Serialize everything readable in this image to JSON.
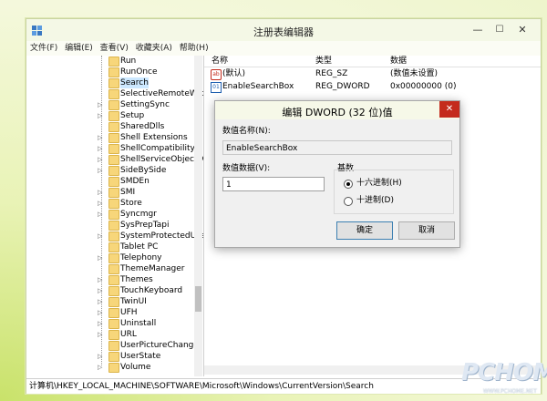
{
  "window": {
    "title": "注册表编辑器",
    "min_label": "—",
    "max_label": "☐",
    "close_label": "✕"
  },
  "menu": [
    "文件(F)",
    "编辑(E)",
    "查看(V)",
    "收藏夹(A)",
    "帮助(H)"
  ],
  "tree": {
    "items": [
      {
        "label": "Run",
        "arrow": ""
      },
      {
        "label": "RunOnce",
        "arrow": ""
      },
      {
        "label": "Search",
        "arrow": "",
        "selected": true
      },
      {
        "label": "SelectiveRemoteWip",
        "arrow": ""
      },
      {
        "label": "SettingSync",
        "arrow": "▷"
      },
      {
        "label": "Setup",
        "arrow": "▷"
      },
      {
        "label": "SharedDlls",
        "arrow": ""
      },
      {
        "label": "Shell Extensions",
        "arrow": "▷"
      },
      {
        "label": "ShellCompatibility",
        "arrow": "▷"
      },
      {
        "label": "ShellServiceObjectD",
        "arrow": "▷"
      },
      {
        "label": "SideBySide",
        "arrow": "▷"
      },
      {
        "label": "SMDEn",
        "arrow": ""
      },
      {
        "label": "SMI",
        "arrow": "▷"
      },
      {
        "label": "Store",
        "arrow": "▷"
      },
      {
        "label": "Syncmgr",
        "arrow": "▷"
      },
      {
        "label": "SysPrepTapi",
        "arrow": ""
      },
      {
        "label": "SystemProtectedUse",
        "arrow": "▷"
      },
      {
        "label": "Tablet PC",
        "arrow": ""
      },
      {
        "label": "Telephony",
        "arrow": "▷"
      },
      {
        "label": "ThemeManager",
        "arrow": ""
      },
      {
        "label": "Themes",
        "arrow": "▷"
      },
      {
        "label": "TouchKeyboard",
        "arrow": "▷"
      },
      {
        "label": "TwinUI",
        "arrow": "▷"
      },
      {
        "label": "UFH",
        "arrow": "▷"
      },
      {
        "label": "Uninstall",
        "arrow": "▷"
      },
      {
        "label": "URL",
        "arrow": "▷"
      },
      {
        "label": "UserPictureChange",
        "arrow": ""
      },
      {
        "label": "UserState",
        "arrow": "▷"
      },
      {
        "label": "Volume",
        "arrow": "▷"
      }
    ]
  },
  "list": {
    "headers": {
      "name": "名称",
      "type": "类型",
      "data": "数据"
    },
    "rows": [
      {
        "icon": "ab",
        "name": "(默认)",
        "type": "REG_SZ",
        "data": "(数值未设置)"
      },
      {
        "icon": "bin",
        "name": "EnableSearchBox",
        "type": "REG_DWORD",
        "data": "0x00000000 (0)"
      }
    ]
  },
  "status": {
    "path": "计算机\\HKEY_LOCAL_MACHINE\\SOFTWARE\\Microsoft\\Windows\\CurrentVersion\\Search"
  },
  "dialog": {
    "title": "编辑 DWORD (32 位)值",
    "close_label": "✕",
    "name_label": "数值名称(N):",
    "name_value": "EnableSearchBox",
    "data_label": "数值数据(V):",
    "data_value": "1",
    "base_label": "基数",
    "hex_label": "十六进制(H)",
    "dec_label": "十进制(D)",
    "selected_base": "hex",
    "ok_label": "确定",
    "cancel_label": "取消"
  },
  "watermark": {
    "text": "PCHOME",
    "url": "WWW.PCHOME.NET"
  }
}
